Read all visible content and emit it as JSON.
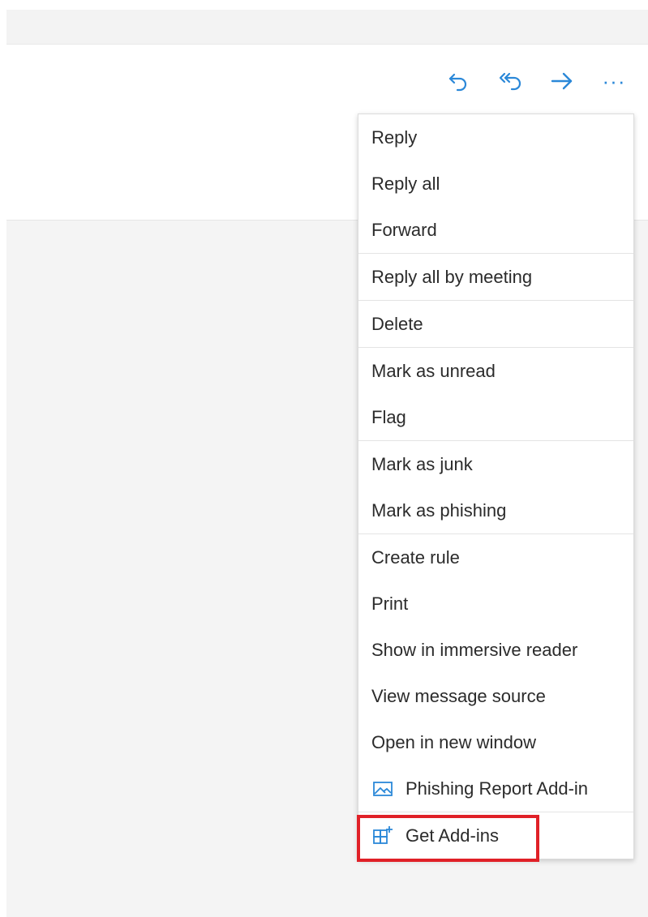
{
  "toolbar": {
    "reply_icon": "reply-icon",
    "reply_all_icon": "reply-all-icon",
    "forward_icon": "forward-arrow-icon",
    "more_label": "···",
    "accent_color": "#2b88d8"
  },
  "menu": {
    "groups": [
      {
        "items": [
          {
            "label": "Reply"
          },
          {
            "label": "Reply all"
          },
          {
            "label": "Forward"
          }
        ]
      },
      {
        "items": [
          {
            "label": "Reply all by meeting"
          }
        ]
      },
      {
        "items": [
          {
            "label": "Delete"
          }
        ]
      },
      {
        "items": [
          {
            "label": "Mark as unread"
          },
          {
            "label": "Flag"
          }
        ]
      },
      {
        "items": [
          {
            "label": "Mark as junk"
          },
          {
            "label": "Mark as phishing"
          }
        ]
      },
      {
        "items": [
          {
            "label": "Create rule"
          },
          {
            "label": "Print"
          },
          {
            "label": "Show in immersive reader"
          },
          {
            "label": "View message source"
          },
          {
            "label": "Open in new window"
          },
          {
            "label": "Phishing Report Add-in",
            "icon": "image-icon"
          }
        ]
      },
      {
        "items": [
          {
            "label": "Get Add-ins",
            "icon": "add-ins-grid-icon"
          }
        ]
      }
    ],
    "highlight_color": "#e02027"
  }
}
